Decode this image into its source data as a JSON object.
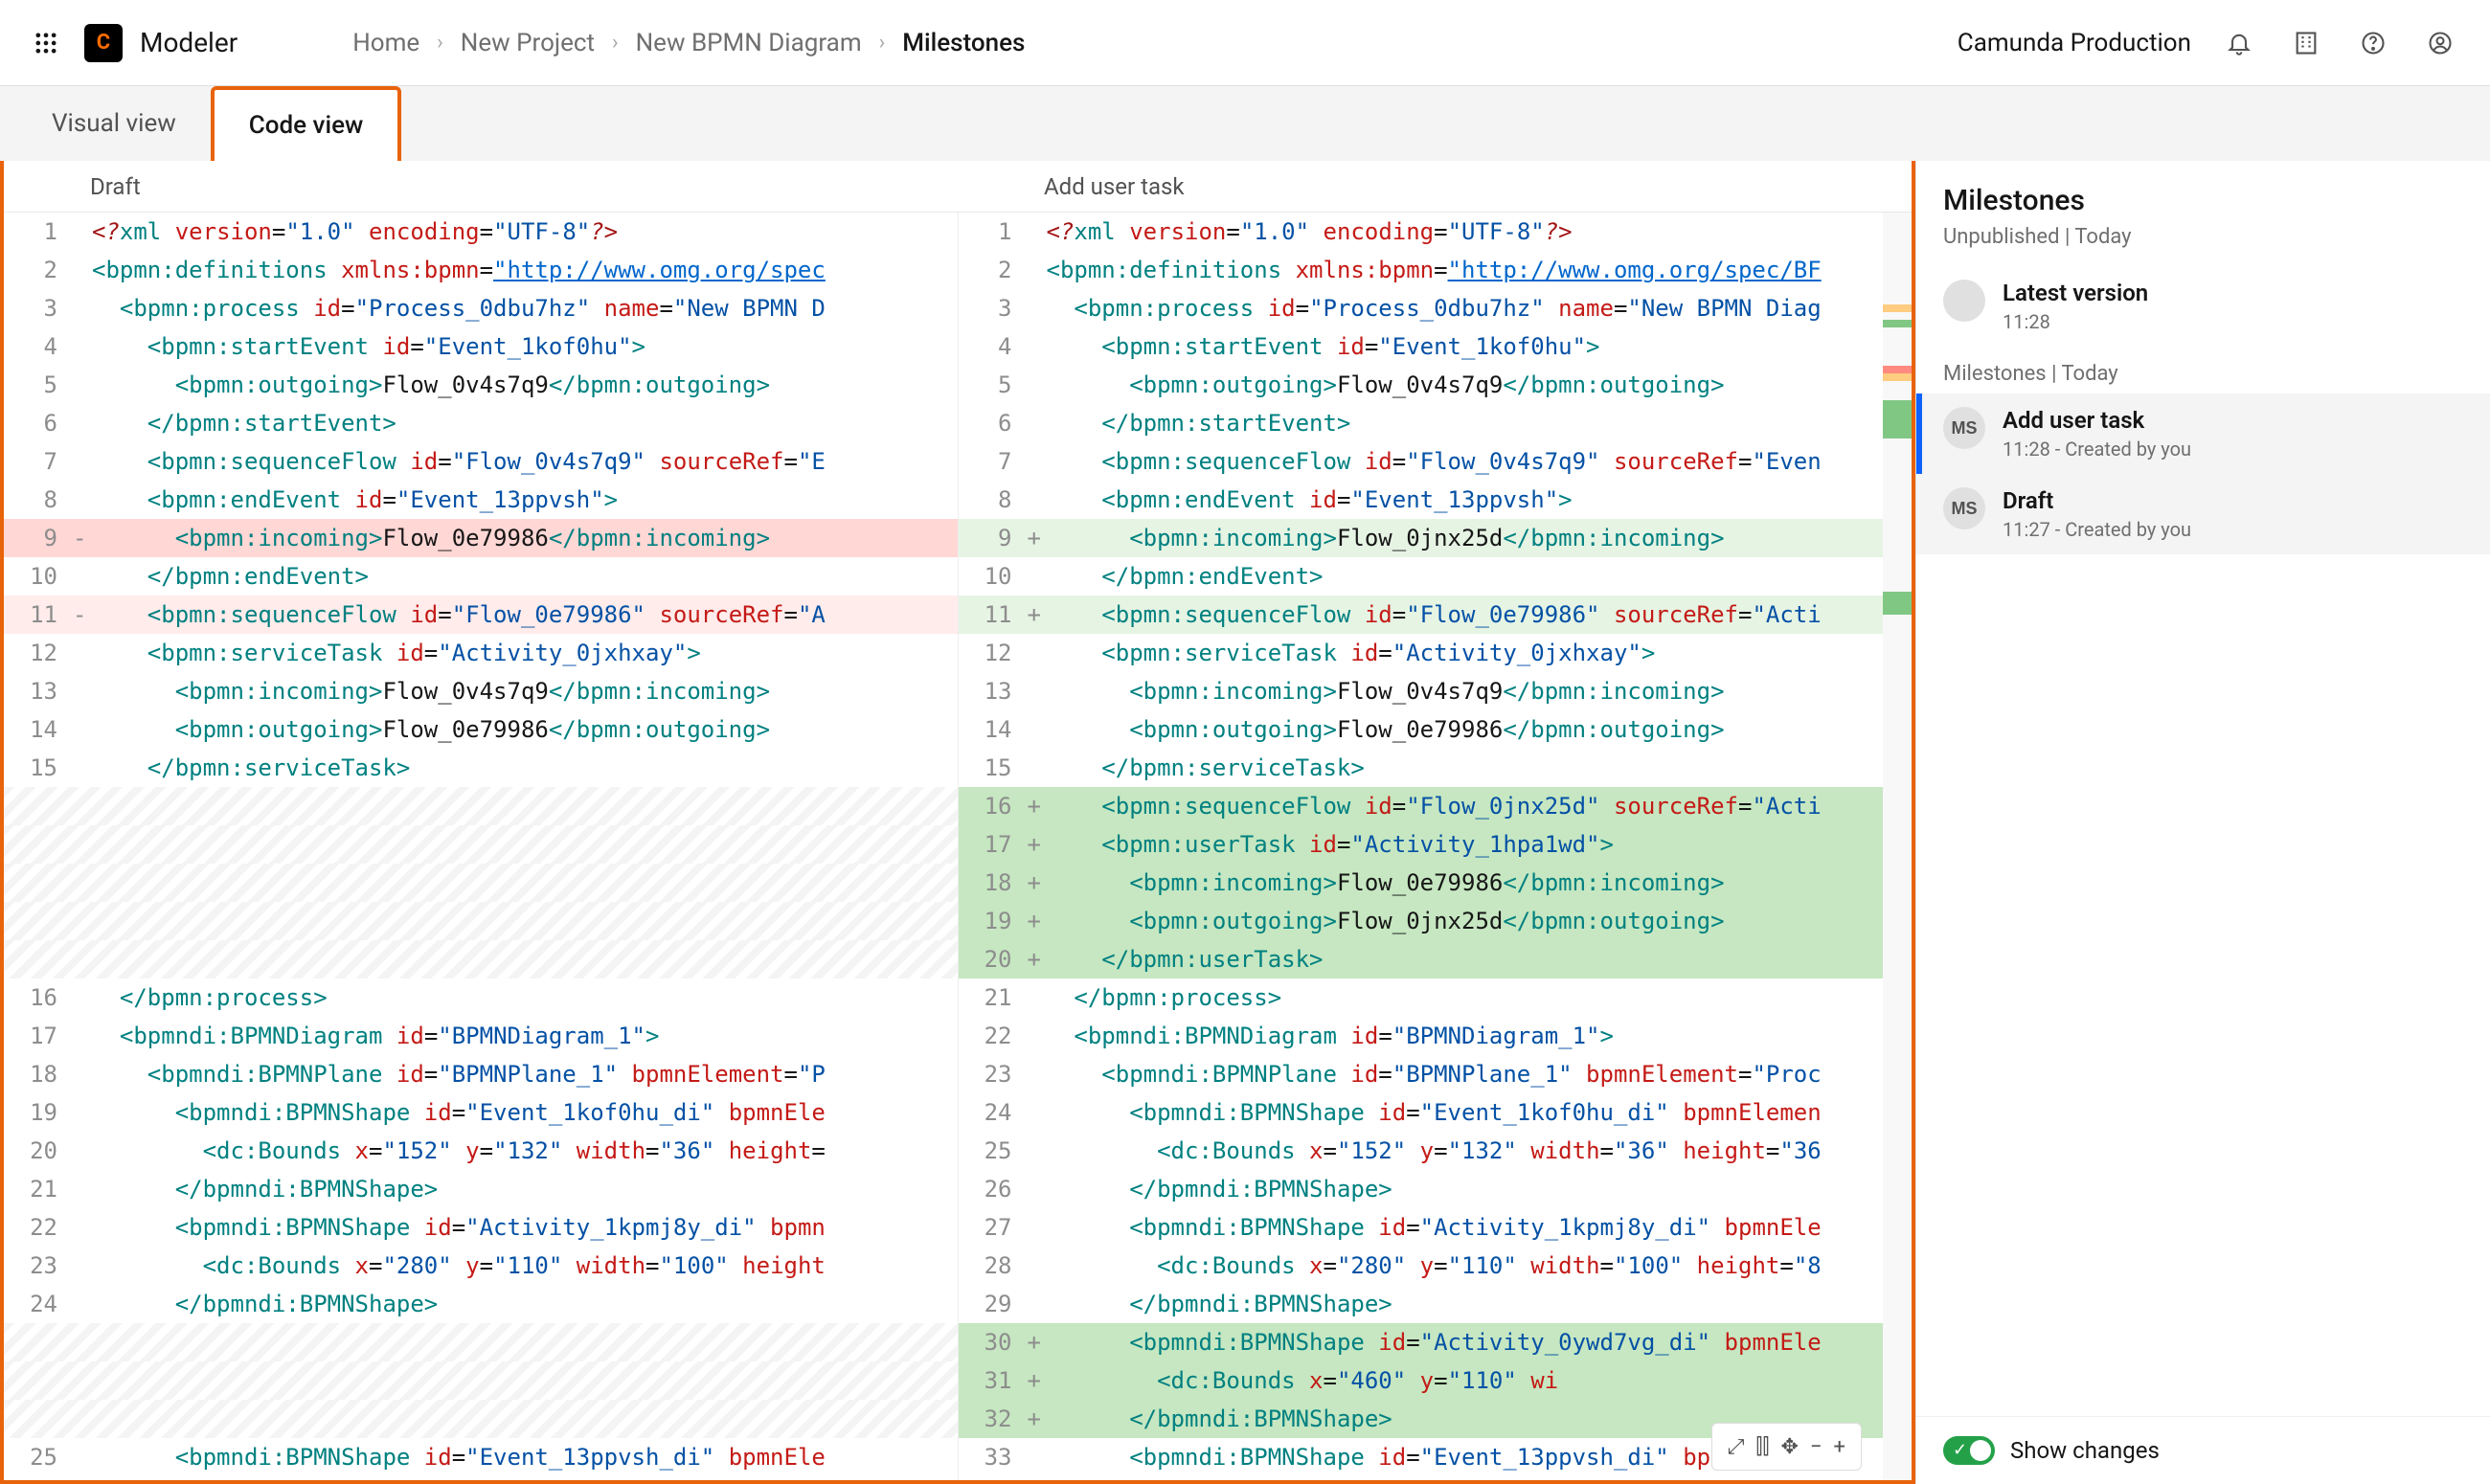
{
  "header": {
    "app_name": "Modeler",
    "breadcrumbs": [
      "Home",
      "New Project",
      "New BPMN Diagram",
      "Milestones"
    ],
    "org_label": "Camunda Production"
  },
  "tabs": {
    "visual": "Visual view",
    "code": "Code view",
    "active": "code"
  },
  "diff": {
    "left_title": "Draft",
    "right_title": "Add user task",
    "left_lines": [
      {
        "n": 1,
        "html": "<span class='tok-pi'>&lt;?</span><span class='tok-tag'>xml</span> <span class='tok-attr'>version</span>=<span class='tok-val'>\"1.0\"</span> <span class='tok-attr'>encoding</span>=<span class='tok-val'>\"UTF-8\"</span><span class='tok-pi'>?&gt;</span>"
      },
      {
        "n": 2,
        "html": "<span class='tok-tag'>&lt;bpmn:definitions</span> <span class='tok-attr'>xmlns:bpmn</span>=<span class='tok-link'>\"http://www.omg.org/spec</span>"
      },
      {
        "n": 3,
        "html": "  <span class='tok-tag'>&lt;bpmn:process</span> <span class='tok-attr'>id</span>=<span class='tok-val'>\"Process_0dbu7hz\"</span> <span class='tok-attr'>name</span>=<span class='tok-val'>\"New BPMN D</span>"
      },
      {
        "n": 4,
        "html": "    <span class='tok-tag'>&lt;bpmn:startEvent</span> <span class='tok-attr'>id</span>=<span class='tok-val'>\"Event_1kof0hu\"</span><span class='tok-tag'>&gt;</span>"
      },
      {
        "n": 5,
        "html": "      <span class='tok-tag'>&lt;bpmn:outgoing&gt;</span>Flow_0v4s7q9<span class='tok-tag'>&lt;/bpmn:outgoing&gt;</span>"
      },
      {
        "n": 6,
        "html": "    <span class='tok-tag'>&lt;/bpmn:startEvent&gt;</span>"
      },
      {
        "n": 7,
        "html": "    <span class='tok-tag'>&lt;bpmn:sequenceFlow</span> <span class='tok-attr'>id</span>=<span class='tok-val'>\"Flow_0v4s7q9\"</span> <span class='tok-attr'>sourceRef</span>=<span class='tok-val'>\"E</span>"
      },
      {
        "n": 8,
        "html": "    <span class='tok-tag'>&lt;bpmn:endEvent</span> <span class='tok-attr'>id</span>=<span class='tok-val'>\"Event_13ppvsh\"</span><span class='tok-tag'>&gt;</span>"
      },
      {
        "n": 9,
        "mark": "-",
        "cls": "row-del",
        "html": "      <span class='tok-tag'>&lt;bpmn:incoming&gt;</span>Flow_0e79986<span class='tok-tag'>&lt;/bpmn:incoming&gt;</span>"
      },
      {
        "n": 10,
        "html": "    <span class='tok-tag'>&lt;/bpmn:endEvent&gt;</span>"
      },
      {
        "n": 11,
        "mark": "-",
        "cls": "row-del-soft",
        "html": "    <span class='tok-tag'>&lt;bpmn:sequenceFlow</span> <span class='tok-attr'>id</span>=<span class='tok-val'>\"Flow_0e79986\"</span> <span class='tok-attr'>sourceRef</span>=<span class='tok-val'>\"A</span>"
      },
      {
        "n": 12,
        "html": "    <span class='tok-tag'>&lt;bpmn:serviceTask</span> <span class='tok-attr'>id</span>=<span class='tok-val'>\"Activity_0jxhxay\"</span><span class='tok-tag'>&gt;</span>"
      },
      {
        "n": 13,
        "html": "      <span class='tok-tag'>&lt;bpmn:incoming&gt;</span>Flow_0v4s7q9<span class='tok-tag'>&lt;/bpmn:incoming&gt;</span>"
      },
      {
        "n": 14,
        "html": "      <span class='tok-tag'>&lt;bpmn:outgoing&gt;</span>Flow_0e79986<span class='tok-tag'>&lt;/bpmn:outgoing&gt;</span>"
      },
      {
        "n": 15,
        "html": "    <span class='tok-tag'>&lt;/bpmn:serviceTask&gt;</span>"
      },
      {
        "cls": "row-hatch",
        "html": " "
      },
      {
        "cls": "row-hatch",
        "html": " "
      },
      {
        "cls": "row-hatch",
        "html": " "
      },
      {
        "cls": "row-hatch",
        "html": " "
      },
      {
        "cls": "row-hatch",
        "html": " "
      },
      {
        "n": 16,
        "html": "  <span class='tok-tag'>&lt;/bpmn:process&gt;</span>"
      },
      {
        "n": 17,
        "html": "  <span class='tok-tag'>&lt;bpmndi:BPMNDiagram</span> <span class='tok-attr'>id</span>=<span class='tok-val'>\"BPMNDiagram_1\"</span><span class='tok-tag'>&gt;</span>"
      },
      {
        "n": 18,
        "html": "    <span class='tok-tag'>&lt;bpmndi:BPMNPlane</span> <span class='tok-attr'>id</span>=<span class='tok-val'>\"BPMNPlane_1\"</span> <span class='tok-attr'>bpmnElement</span>=<span class='tok-val'>\"P</span>"
      },
      {
        "n": 19,
        "html": "      <span class='tok-tag'>&lt;bpmndi:BPMNShape</span> <span class='tok-attr'>id</span>=<span class='tok-val'>\"Event_1kof0hu_di\"</span> <span class='tok-attr'>bpmnEle</span>"
      },
      {
        "n": 20,
        "html": "        <span class='tok-tag'>&lt;dc:Bounds</span> <span class='tok-attr'>x</span>=<span class='tok-val'>\"152\"</span> <span class='tok-attr'>y</span>=<span class='tok-val'>\"132\"</span> <span class='tok-attr'>width</span>=<span class='tok-val'>\"36\"</span> <span class='tok-attr'>height</span>="
      },
      {
        "n": 21,
        "html": "      <span class='tok-tag'>&lt;/bpmndi:BPMNShape&gt;</span>"
      },
      {
        "n": 22,
        "html": "      <span class='tok-tag'>&lt;bpmndi:BPMNShape</span> <span class='tok-attr'>id</span>=<span class='tok-val'>\"Activity_1kpmj8y_di\"</span> <span class='tok-attr'>bpmn</span>"
      },
      {
        "n": 23,
        "html": "        <span class='tok-tag'>&lt;dc:Bounds</span> <span class='tok-attr'>x</span>=<span class='tok-val'>\"280\"</span> <span class='tok-attr'>y</span>=<span class='tok-val'>\"110\"</span> <span class='tok-attr'>width</span>=<span class='tok-val'>\"100\"</span> <span class='tok-attr'>height</span>"
      },
      {
        "n": 24,
        "html": "      <span class='tok-tag'>&lt;/bpmndi:BPMNShape&gt;</span>"
      },
      {
        "cls": "row-hatch",
        "html": " "
      },
      {
        "cls": "row-hatch",
        "html": " "
      },
      {
        "cls": "row-hatch",
        "html": " "
      },
      {
        "n": 25,
        "html": "      <span class='tok-tag'>&lt;bpmndi:BPMNShape</span> <span class='tok-attr'>id</span>=<span class='tok-val'>\"Event_13ppvsh_di\"</span> <span class='tok-attr'>bpmnEle</span>"
      }
    ],
    "right_lines": [
      {
        "n": 1,
        "html": "<span class='tok-pi'>&lt;?</span><span class='tok-tag'>xml</span> <span class='tok-attr'>version</span>=<span class='tok-val'>\"1.0\"</span> <span class='tok-attr'>encoding</span>=<span class='tok-val'>\"UTF-8\"</span><span class='tok-pi'>?&gt;</span>"
      },
      {
        "n": 2,
        "html": "<span class='tok-tag'>&lt;bpmn:definitions</span> <span class='tok-attr'>xmlns:bpmn</span>=<span class='tok-link'>\"http://www.omg.org/spec/BF</span>"
      },
      {
        "n": 3,
        "html": "  <span class='tok-tag'>&lt;bpmn:process</span> <span class='tok-attr'>id</span>=<span class='tok-val'>\"Process_0dbu7hz\"</span> <span class='tok-attr'>name</span>=<span class='tok-val'>\"New BPMN Diag</span>"
      },
      {
        "n": 4,
        "html": "    <span class='tok-tag'>&lt;bpmn:startEvent</span> <span class='tok-attr'>id</span>=<span class='tok-val'>\"Event_1kof0hu\"</span><span class='tok-tag'>&gt;</span>"
      },
      {
        "n": 5,
        "html": "      <span class='tok-tag'>&lt;bpmn:outgoing&gt;</span>Flow_0v4s7q9<span class='tok-tag'>&lt;/bpmn:outgoing&gt;</span>"
      },
      {
        "n": 6,
        "html": "    <span class='tok-tag'>&lt;/bpmn:startEvent&gt;</span>"
      },
      {
        "n": 7,
        "html": "    <span class='tok-tag'>&lt;bpmn:sequenceFlow</span> <span class='tok-attr'>id</span>=<span class='tok-val'>\"Flow_0v4s7q9\"</span> <span class='tok-attr'>sourceRef</span>=<span class='tok-val'>\"Even</span>"
      },
      {
        "n": 8,
        "html": "    <span class='tok-tag'>&lt;bpmn:endEvent</span> <span class='tok-attr'>id</span>=<span class='tok-val'>\"Event_13ppvsh\"</span><span class='tok-tag'>&gt;</span>"
      },
      {
        "n": 9,
        "mark": "+",
        "cls": "row-add-soft",
        "html": "      <span class='tok-tag'>&lt;bpmn:incoming&gt;</span>Flow_0jnx25d<span class='tok-tag'>&lt;/bpmn:incoming&gt;</span>"
      },
      {
        "n": 10,
        "html": "    <span class='tok-tag'>&lt;/bpmn:endEvent&gt;</span>"
      },
      {
        "n": 11,
        "mark": "+",
        "cls": "row-add-soft",
        "html": "    <span class='tok-tag'>&lt;bpmn:sequenceFlow</span> <span class='tok-attr'>id</span>=<span class='tok-val'>\"Flow_0e79986\"</span> <span class='tok-attr'>sourceRef</span>=<span class='tok-val'>\"Acti</span>"
      },
      {
        "n": 12,
        "html": "    <span class='tok-tag'>&lt;bpmn:serviceTask</span> <span class='tok-attr'>id</span>=<span class='tok-val'>\"Activity_0jxhxay\"</span><span class='tok-tag'>&gt;</span>"
      },
      {
        "n": 13,
        "html": "      <span class='tok-tag'>&lt;bpmn:incoming&gt;</span>Flow_0v4s7q9<span class='tok-tag'>&lt;/bpmn:incoming&gt;</span>"
      },
      {
        "n": 14,
        "html": "      <span class='tok-tag'>&lt;bpmn:outgoing&gt;</span>Flow_0e79986<span class='tok-tag'>&lt;/bpmn:outgoing&gt;</span>"
      },
      {
        "n": 15,
        "html": "    <span class='tok-tag'>&lt;/bpmn:serviceTask&gt;</span>"
      },
      {
        "n": 16,
        "mark": "+",
        "cls": "row-add",
        "html": "    <span class='tok-tag'>&lt;bpmn:sequenceFlow</span> <span class='tok-attr'>id</span>=<span class='tok-val'>\"Flow_0jnx25d\"</span> <span class='tok-attr'>sourceRef</span>=<span class='tok-val'>\"Acti</span>"
      },
      {
        "n": 17,
        "mark": "+",
        "cls": "row-add",
        "html": "    <span class='tok-tag'>&lt;bpmn:userTask</span> <span class='tok-attr'>id</span>=<span class='tok-val'>\"Activity_1hpa1wd\"</span><span class='tok-tag'>&gt;</span>"
      },
      {
        "n": 18,
        "mark": "+",
        "cls": "row-add",
        "html": "      <span class='tok-tag'>&lt;bpmn:incoming&gt;</span>Flow_0e79986<span class='tok-tag'>&lt;/bpmn:incoming&gt;</span>"
      },
      {
        "n": 19,
        "mark": "+",
        "cls": "row-add",
        "html": "      <span class='tok-tag'>&lt;bpmn:outgoing&gt;</span>Flow_0jnx25d<span class='tok-tag'>&lt;/bpmn:outgoing&gt;</span>"
      },
      {
        "n": 20,
        "mark": "+",
        "cls": "row-add",
        "html": "    <span class='tok-tag'>&lt;/bpmn:userTask&gt;</span>"
      },
      {
        "n": 21,
        "html": "  <span class='tok-tag'>&lt;/bpmn:process&gt;</span>"
      },
      {
        "n": 22,
        "html": "  <span class='tok-tag'>&lt;bpmndi:BPMNDiagram</span> <span class='tok-attr'>id</span>=<span class='tok-val'>\"BPMNDiagram_1\"</span><span class='tok-tag'>&gt;</span>"
      },
      {
        "n": 23,
        "html": "    <span class='tok-tag'>&lt;bpmndi:BPMNPlane</span> <span class='tok-attr'>id</span>=<span class='tok-val'>\"BPMNPlane_1\"</span> <span class='tok-attr'>bpmnElement</span>=<span class='tok-val'>\"Proc</span>"
      },
      {
        "n": 24,
        "html": "      <span class='tok-tag'>&lt;bpmndi:BPMNShape</span> <span class='tok-attr'>id</span>=<span class='tok-val'>\"Event_1kof0hu_di\"</span> <span class='tok-attr'>bpmnElemen</span>"
      },
      {
        "n": 25,
        "html": "        <span class='tok-tag'>&lt;dc:Bounds</span> <span class='tok-attr'>x</span>=<span class='tok-val'>\"152\"</span> <span class='tok-attr'>y</span>=<span class='tok-val'>\"132\"</span> <span class='tok-attr'>width</span>=<span class='tok-val'>\"36\"</span> <span class='tok-attr'>height</span>=<span class='tok-val'>\"36</span>"
      },
      {
        "n": 26,
        "html": "      <span class='tok-tag'>&lt;/bpmndi:BPMNShape&gt;</span>"
      },
      {
        "n": 27,
        "html": "      <span class='tok-tag'>&lt;bpmndi:BPMNShape</span> <span class='tok-attr'>id</span>=<span class='tok-val'>\"Activity_1kpmj8y_di\"</span> <span class='tok-attr'>bpmnEle</span>"
      },
      {
        "n": 28,
        "html": "        <span class='tok-tag'>&lt;dc:Bounds</span> <span class='tok-attr'>x</span>=<span class='tok-val'>\"280\"</span> <span class='tok-attr'>y</span>=<span class='tok-val'>\"110\"</span> <span class='tok-attr'>width</span>=<span class='tok-val'>\"100\"</span> <span class='tok-attr'>height</span>=<span class='tok-val'>\"8</span>"
      },
      {
        "n": 29,
        "html": "      <span class='tok-tag'>&lt;/bpmndi:BPMNShape&gt;</span>"
      },
      {
        "n": 30,
        "mark": "+",
        "cls": "row-add",
        "html": "      <span class='tok-tag'>&lt;bpmndi:BPMNShape</span> <span class='tok-attr'>id</span>=<span class='tok-val'>\"Activity_0ywd7vg_di\"</span> <span class='tok-attr'>bpmnEle</span>"
      },
      {
        "n": 31,
        "mark": "+",
        "cls": "row-add",
        "html": "        <span class='tok-tag'>&lt;dc:Bounds</span> <span class='tok-attr'>x</span>=<span class='tok-val'>\"460\"</span> <span class='tok-attr'>y</span>=<span class='tok-val'>\"110\"</span> <span class='tok-attr'>wi</span>"
      },
      {
        "n": 32,
        "mark": "+",
        "cls": "row-add",
        "html": "      <span class='tok-tag'>&lt;/bpmndi:BPMNShape&gt;</span>"
      },
      {
        "n": 33,
        "html": "      <span class='tok-tag'>&lt;bpmndi:BPMNShape</span> <span class='tok-attr'>id</span>=<span class='tok-val'>\"Event_13ppvsh_di\"</span> <span class='tok-attr'>bpmnElemen</span>"
      }
    ]
  },
  "sidebar": {
    "title": "Milestones",
    "unpublished_header": "Unpublished | Today",
    "latest": {
      "title": "Latest version",
      "time": "11:28"
    },
    "milestones_header": "Milestones | Today",
    "items": [
      {
        "initials": "MS",
        "title": "Add user task",
        "sub": "11:28 - Created by you",
        "selected": true
      },
      {
        "initials": "MS",
        "title": "Draft",
        "sub": "11:27 - Created by you",
        "selected": false
      }
    ],
    "toggle_label": "Show changes"
  }
}
